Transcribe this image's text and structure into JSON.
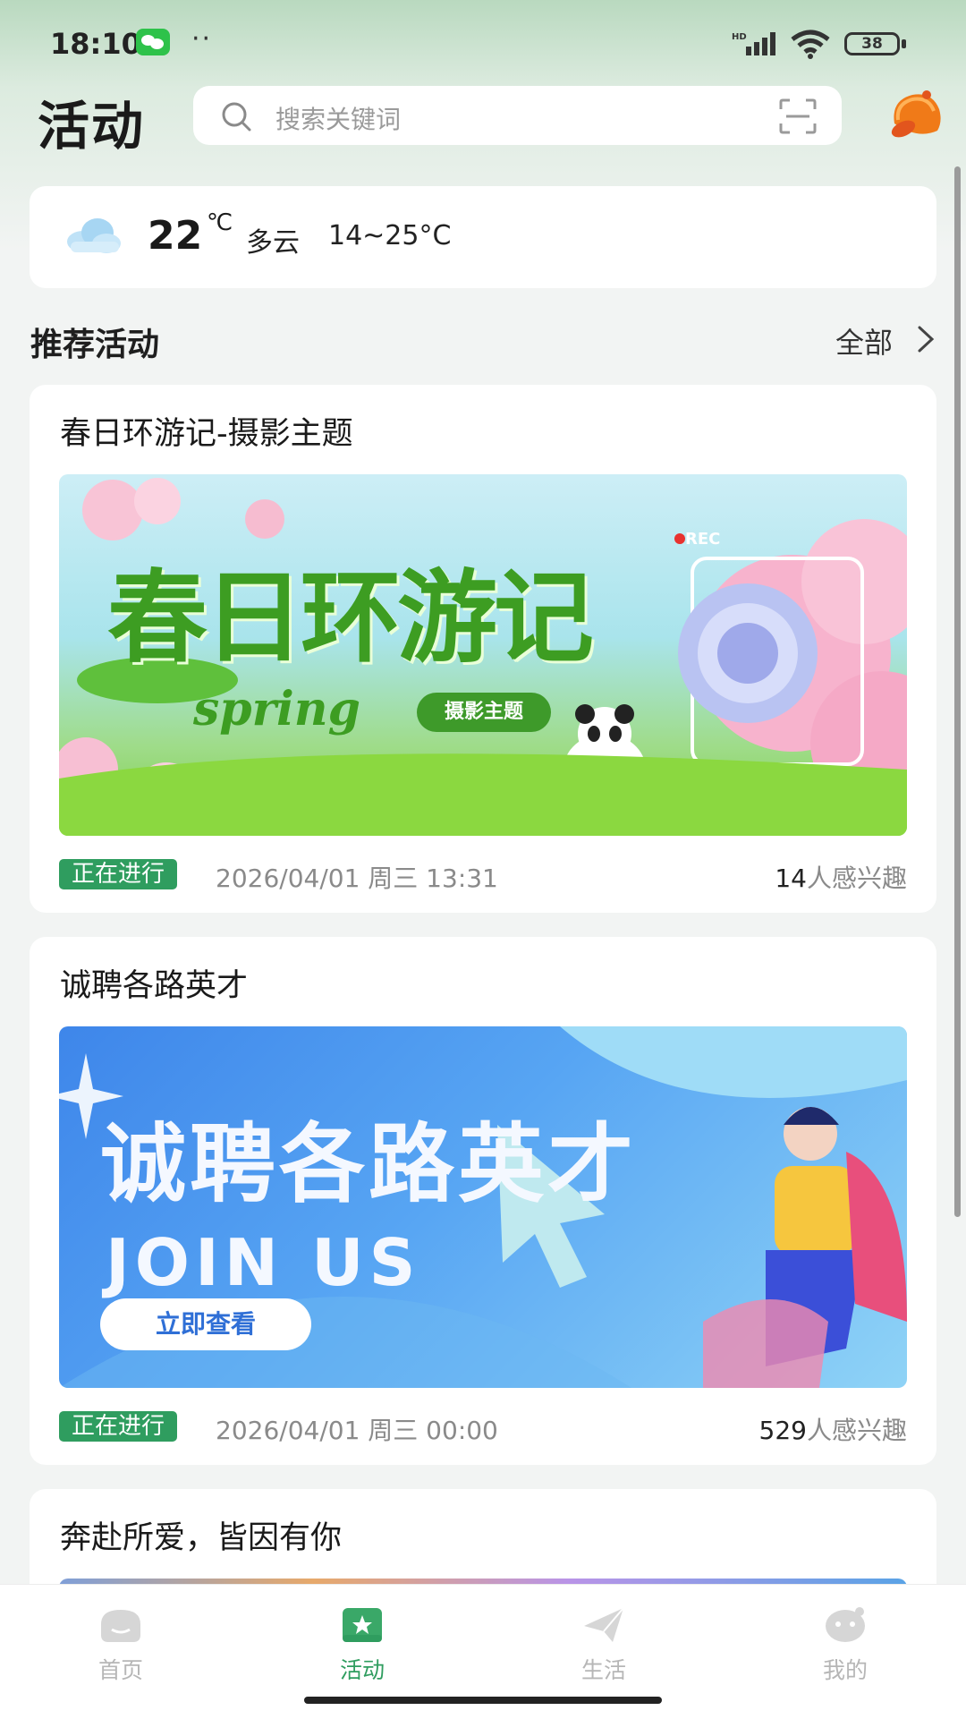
{
  "status_bar": {
    "time": "18:10",
    "dots": "··",
    "battery": "38",
    "network_label": "HD"
  },
  "header": {
    "title": "活动",
    "search_placeholder": "搜索关键词"
  },
  "weather": {
    "temperature": "22",
    "unit": "℃",
    "condition": "多云",
    "range": "14~25°C"
  },
  "section": {
    "title": "推荐活动",
    "see_all": "全部"
  },
  "activities": [
    {
      "title": "春日环游记-摄影主题",
      "status": "正在进行",
      "date": "2026/04/01 周三 13:31",
      "interest_count": "14",
      "interest_suffix": "人感兴趣",
      "banner": {
        "heading": "春日环游记",
        "sub": "spring",
        "pill": "摄影主题",
        "rec": "REC"
      }
    },
    {
      "title": "诚聘各路英才",
      "status": "正在进行",
      "date": "2026/04/01 周三 00:00",
      "interest_count": "529",
      "interest_suffix": "人感兴趣",
      "banner": {
        "heading": "诚聘各路英才",
        "sub": "JOIN US",
        "button": "立即查看"
      }
    },
    {
      "title": "奔赴所爱，皆因有你"
    }
  ],
  "bottom_nav": [
    {
      "label": "首页",
      "icon": "home-icon",
      "active": false
    },
    {
      "label": "活动",
      "icon": "activity-icon",
      "active": true
    },
    {
      "label": "生活",
      "icon": "paper-plane-icon",
      "active": false
    },
    {
      "label": "我的",
      "icon": "profile-icon",
      "active": false
    }
  ],
  "colors": {
    "accent": "#2f9d5f",
    "background": "#f2f4f3",
    "nav_inactive": "#b6b6b6"
  }
}
